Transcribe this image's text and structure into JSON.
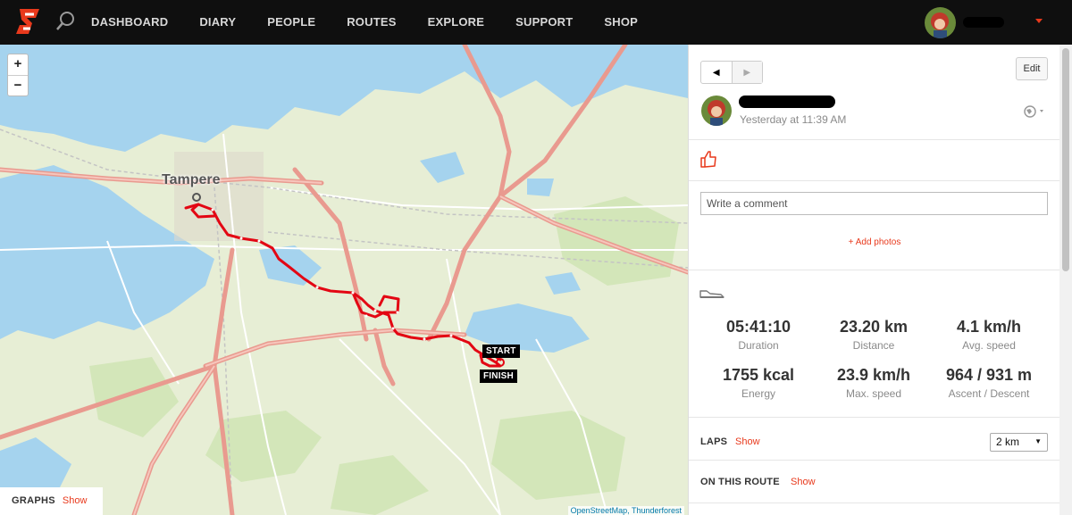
{
  "nav": {
    "items": [
      "DASHBOARD",
      "DIARY",
      "PEOPLE",
      "ROUTES",
      "EXPLORE",
      "SUPPORT",
      "SHOP"
    ]
  },
  "map": {
    "city": "Tampere",
    "start_label": "START",
    "finish_label": "FINISH",
    "zoom_in": "+",
    "zoom_out": "−",
    "attribution": "OpenStreetMap, Thunderforest",
    "graphs_label": "GRAPHS",
    "graphs_show": "Show",
    "route_color": "#e30613"
  },
  "post": {
    "pager_prev": "◀",
    "pager_next": "▶",
    "edit": "Edit",
    "timestamp": "Yesterday at 11:39 AM",
    "comment_placeholder": "Write a comment",
    "add_photos": "+ Add photos"
  },
  "stats": [
    {
      "value": "05:41:10",
      "label": "Duration"
    },
    {
      "value": "23.20 km",
      "label": "Distance"
    },
    {
      "value": "4.1 km/h",
      "label": "Avg. speed"
    },
    {
      "value": "1755 kcal",
      "label": "Energy"
    },
    {
      "value": "23.9 km/h",
      "label": "Max. speed"
    },
    {
      "value": "964 / 931 m",
      "label": "Ascent / Descent"
    }
  ],
  "laps": {
    "label": "LAPS",
    "show": "Show",
    "selected": "2 km"
  },
  "on_route": {
    "label": "ON THIS ROUTE",
    "show": "Show"
  },
  "colors": {
    "accent": "#e8391c",
    "topbar": "#0f0f0f"
  }
}
